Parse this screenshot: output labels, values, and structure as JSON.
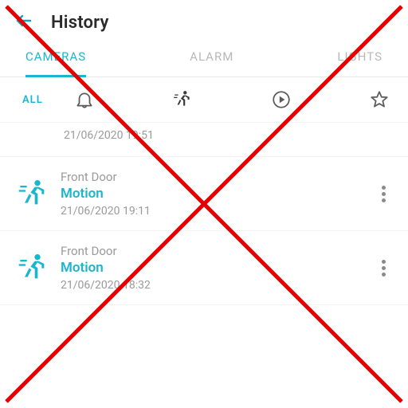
{
  "header": {
    "title": "History"
  },
  "tabs": [
    {
      "label": "CAMERAS",
      "active": true
    },
    {
      "label": "ALARM",
      "active": false
    },
    {
      "label": "LIGHTS",
      "active": false
    }
  ],
  "filters": {
    "all_label": "ALL"
  },
  "orphan_timestamp": "21/06/2020 19:51",
  "events": [
    {
      "camera": "Front Door",
      "kind": "Motion",
      "timestamp": "21/06/2020 19:11"
    },
    {
      "camera": "Front Door",
      "kind": "Motion",
      "timestamp": "21/06/2020 18:32"
    }
  ],
  "colors": {
    "accent": "#19b6cf",
    "muted": "#9a9a9a",
    "overlay": "#e60000"
  },
  "overlay": {
    "crossed_out": true
  }
}
